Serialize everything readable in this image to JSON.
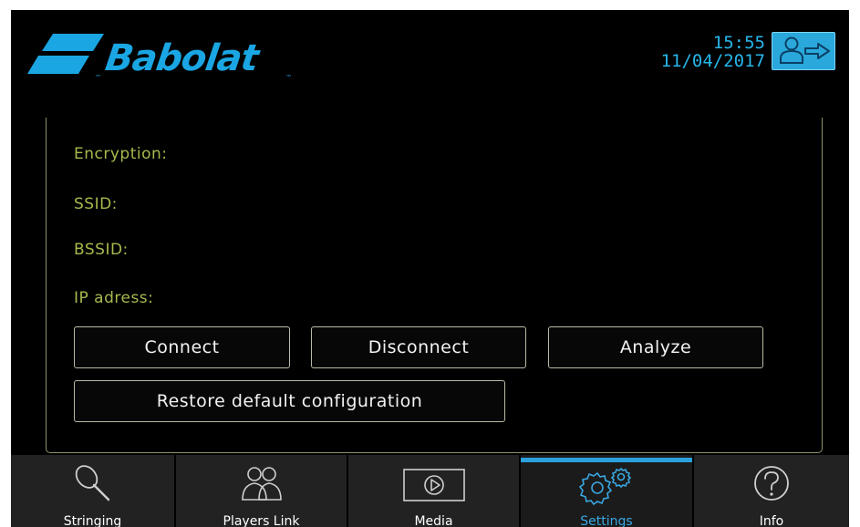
{
  "header": {
    "brand": "Babolat",
    "time": "15:55",
    "date": "11/04/2017",
    "logout_icon": "user-exit-icon"
  },
  "network": {
    "fields": [
      "Encryption:",
      "SSID:",
      "BSSID:",
      "IP adress:"
    ],
    "buttons": {
      "connect": "Connect",
      "disconnect": "Disconnect",
      "analyze": "Analyze",
      "restore": "Restore default configuration"
    }
  },
  "nav": {
    "tabs": [
      {
        "label": "Stringing",
        "icon": "racket-icon"
      },
      {
        "label": "Players Link",
        "icon": "users-icon"
      },
      {
        "label": "Media",
        "icon": "play-icon"
      },
      {
        "label": "Settings",
        "icon": "gears-icon",
        "active": true
      },
      {
        "label": "Info",
        "icon": "help-icon"
      }
    ]
  },
  "colors": {
    "accent": "#2ca0dc",
    "label_green": "#a9b84d",
    "background": "#000000"
  }
}
